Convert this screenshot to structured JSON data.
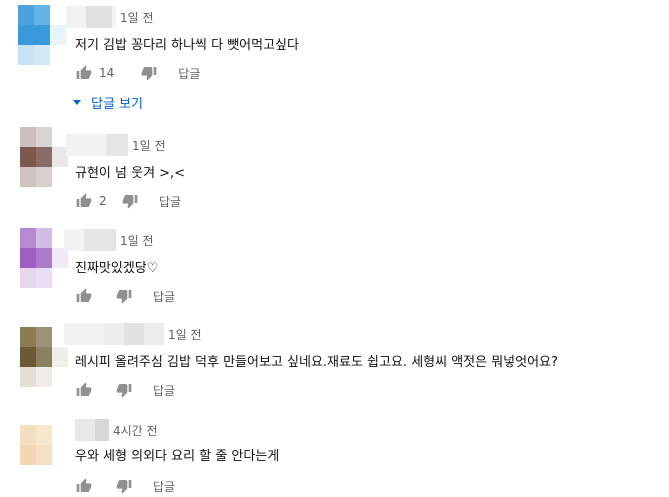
{
  "comments": [
    {
      "time": "1일 전",
      "text": "저기 김밥 꽁다리 하나씩 다 뺏어먹고싶다",
      "likes": "14",
      "reply_label": "답글",
      "view_replies_label": "답글 보기",
      "avatar_colors": [
        "#4aa3df",
        "#63b3e6",
        "#ffffff",
        "#3a99db",
        "#3b9ad9",
        "#e8f3fb",
        "#c7e2f4",
        "#d4e9f7",
        "#ffffff"
      ]
    },
    {
      "time": "1일 전",
      "text": "규현이 넘 웃겨 >,<",
      "likes": "2",
      "reply_label": "답글",
      "avatar_colors": [
        "#c9bfbc",
        "#d9d4d3",
        "#ffffff",
        "#7c5850",
        "#8a6b66",
        "#ebe7e6",
        "#cfc3c0",
        "#d8d0ce",
        "#ffffff"
      ]
    },
    {
      "time": "1일 전",
      "text": "진짜맛있겠당♡",
      "likes": "",
      "reply_label": "답글",
      "avatar_colors": [
        "#b68ad1",
        "#d4bde4",
        "#ffffff",
        "#9f5fc2",
        "#a97cc9",
        "#f1e9f6",
        "#e5d7ee",
        "#e9def1",
        "#ffffff"
      ]
    },
    {
      "time": "1일 전",
      "text": "레시피 올려주심 김밥 덕후 만들어보고 싶네요.재료도 쉽고요. 세형씨 액젓은 뭐넣엇어요?",
      "likes": "",
      "reply_label": "답글",
      "avatar_colors": [
        "#8c7c53",
        "#9d9279",
        "#ffffff",
        "#6b5a33",
        "#8b8060",
        "#f0eee8",
        "#e4dfd2",
        "#efede7",
        "#ffffff"
      ]
    },
    {
      "time": "4시간 전",
      "text": "우와 세형 의외다 요리 할 줄 안다는게",
      "likes": "",
      "reply_label": "답글",
      "avatar_colors": [
        "#f6dfc0",
        "#f8e6cd",
        "#ffffff",
        "#f3d6b2",
        "#f6e0c4",
        "#ffffff",
        "#ffffff",
        "#ffffff",
        "#ffffff"
      ]
    }
  ],
  "colors": {
    "text": "#111111",
    "meta": "#606060",
    "link": "#065fd4",
    "icon": "#909090"
  },
  "icons": {
    "like": "thumb-up-icon",
    "dislike": "thumb-down-icon",
    "expand": "caret-down-icon"
  }
}
